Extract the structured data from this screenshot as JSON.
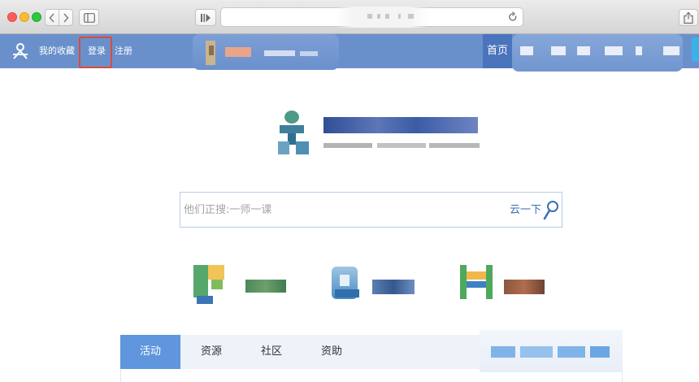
{
  "browser": {
    "colors": {
      "close": "#fc5f57",
      "minimize": "#fdbc2e",
      "zoom": "#29c940"
    },
    "icons": [
      "back-icon",
      "forward-icon",
      "sidebar-icon",
      "reader-icon",
      "reload-icon",
      "share-icon"
    ]
  },
  "header": {
    "favorites_label": "我的收藏",
    "login_label": "登录",
    "register_label": "注册",
    "home_label": "首页",
    "colors": {
      "bar": "#6a90cc",
      "home": "#4a74bb",
      "highlight": "#e04a3a"
    }
  },
  "search": {
    "placeholder": "他们正搜:一师一课",
    "button_label": "云一下",
    "icon": "search-icon"
  },
  "tabs": [
    {
      "label": "活动",
      "active": true
    },
    {
      "label": "资源",
      "active": false
    },
    {
      "label": "社区",
      "active": false
    },
    {
      "label": "资助",
      "active": false
    }
  ],
  "colors": {
    "tab_active": "#5f96dd",
    "tab_bar": "#eef2f9",
    "search_border": "#b9cce6"
  }
}
